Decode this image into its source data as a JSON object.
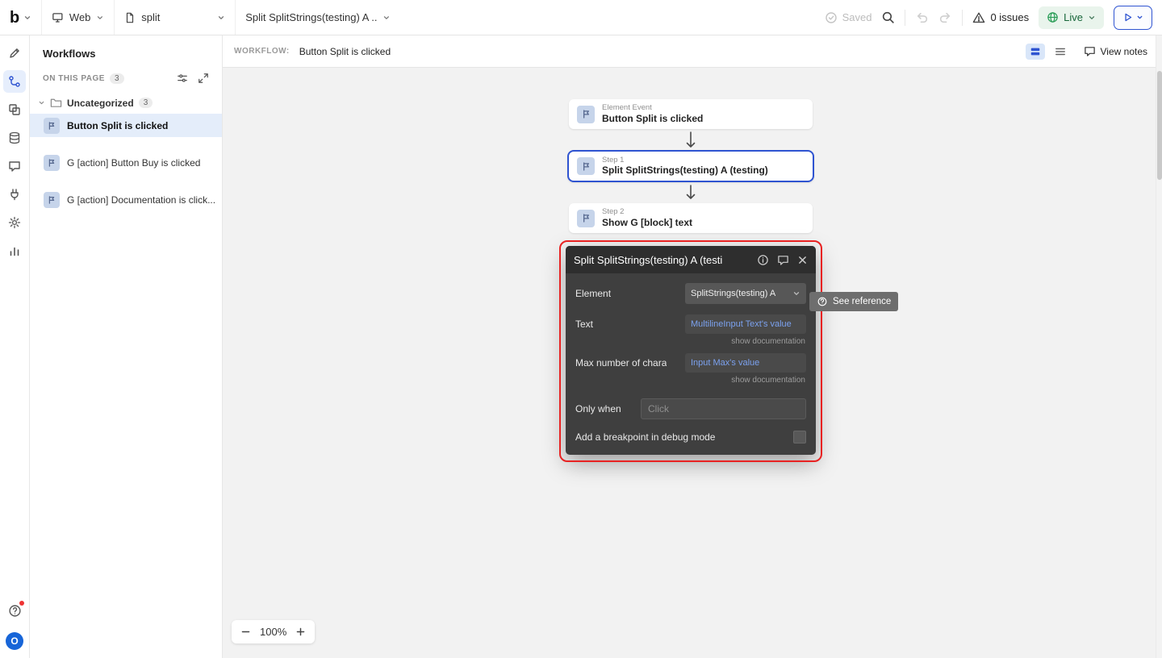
{
  "icons": {
    "logo": "b"
  },
  "topbar": {
    "app_dropdown": {
      "label": "Web"
    },
    "page_dropdown": {
      "label": "split"
    },
    "workflow_dropdown": {
      "label": "Split SplitStrings(testing) A ..."
    },
    "saved": "Saved",
    "issues": "0 issues",
    "live": "Live"
  },
  "rail": {
    "avatar_initial": "O"
  },
  "left_panel": {
    "title": "Workflows",
    "section_label": "ON THIS PAGE",
    "section_count": "3",
    "folder_name": "Uncategorized",
    "folder_count": "3",
    "items": [
      {
        "label": "Button Split is clicked"
      },
      {
        "label": "G [action] Button Buy is clicked"
      },
      {
        "label": "G [action] Documentation is click..."
      }
    ]
  },
  "canvas": {
    "workflow_label": "WORKFLOW:",
    "workflow_name": "Button Split is clicked",
    "view_notes": "View notes",
    "zoom": "100%",
    "nodes": [
      {
        "kind": "Element Event",
        "title": "Button Split is clicked"
      },
      {
        "kind": "Step 1",
        "title": "Split SplitStrings(testing) A (testing)"
      },
      {
        "kind": "Step 2",
        "title": "Show G [block] text"
      }
    ]
  },
  "popup": {
    "title": "Split SplitStrings(testing) A (testi",
    "element_label": "Element",
    "element_value": "SplitStrings(testing) A",
    "text_label": "Text",
    "text_value": "MultilineInput Text's value",
    "show_documentation": "show documentation",
    "max_label": "Max number of chara",
    "max_value": "Input Max's value",
    "only_when_label": "Only when",
    "only_when_placeholder": "Click",
    "breakpoint_label": "Add a breakpoint in debug mode",
    "see_reference": "See reference"
  },
  "colors": {
    "accent_blue": "#2f54d1",
    "live_green": "#17663a",
    "annotation_red": "#e82222",
    "expression_blue": "#7ba1ee",
    "selected_row_blue": "#e4edfa"
  }
}
